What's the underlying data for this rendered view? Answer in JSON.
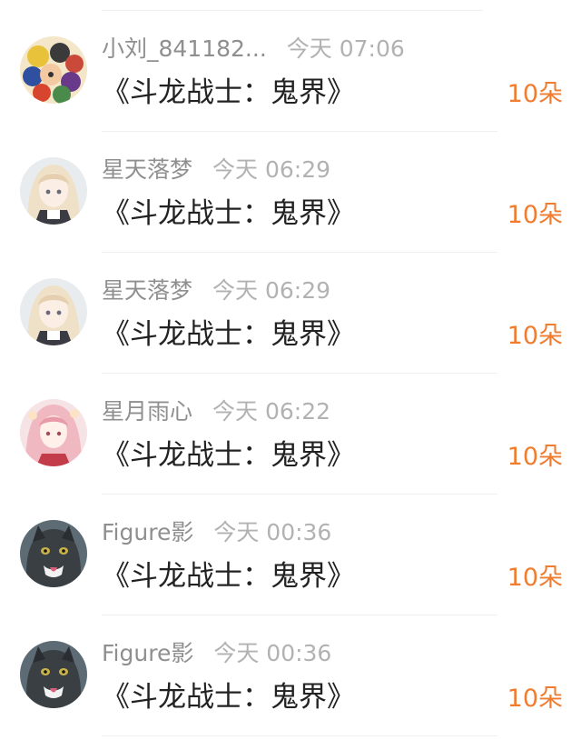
{
  "colors": {
    "amount": "#f07c2f",
    "name": "#8f8f8f",
    "time": "#b2b2b2",
    "title": "#222222"
  },
  "rows": [
    {
      "name": "小刘_841182...",
      "time": "今天 07:06",
      "title": "《斗龙战士：鬼界》",
      "amount": "10朵",
      "avatar": "group-cartoon-avatar"
    },
    {
      "name": "星天落梦",
      "time": "今天 06:29",
      "title": "《斗龙战士：鬼界》",
      "amount": "10朵",
      "avatar": "anime-girl-avatar"
    },
    {
      "name": "星天落梦",
      "time": "今天 06:29",
      "title": "《斗龙战士：鬼界》",
      "amount": "10朵",
      "avatar": "anime-girl-avatar"
    },
    {
      "name": "星月雨心",
      "time": "今天 06:22",
      "title": "《斗龙战士：鬼界》",
      "amount": "10朵",
      "avatar": "anime-pink-girl-avatar"
    },
    {
      "name": "Figure影",
      "time": "今天 00:36",
      "title": "《斗龙战士：鬼界》",
      "amount": "10朵",
      "avatar": "cat-avatar"
    },
    {
      "name": "Figure影",
      "time": "今天 00:36",
      "title": "《斗龙战士：鬼界》",
      "amount": "10朵",
      "avatar": "cat-avatar"
    }
  ]
}
